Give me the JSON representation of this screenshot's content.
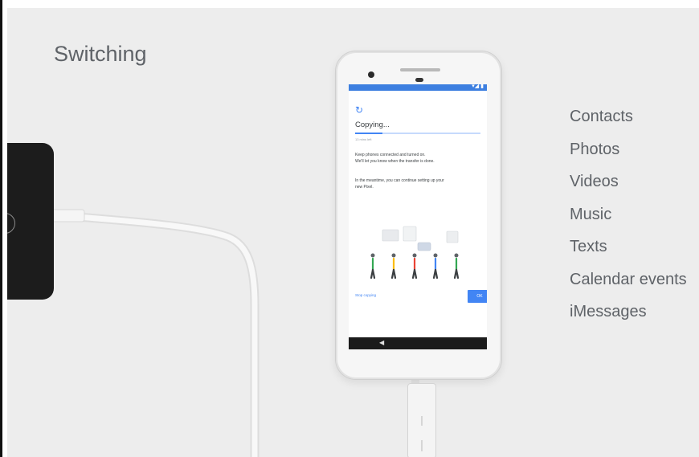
{
  "slide": {
    "title": "Switching",
    "items": [
      "Contacts",
      "Photos",
      "Videos",
      "Music",
      "Texts",
      "Calendar events",
      "iMessages"
    ]
  },
  "screen": {
    "status_icons": "▾◢ ▮",
    "title": "Copying...",
    "progress": 0.22,
    "time_left": "13 mins left",
    "paragraph1": [
      "Keep phones connected and turned on.",
      "We'll let you know when the transfer is done."
    ],
    "paragraph2": [
      "In the meantime, you can continue setting up your",
      "new Pixel."
    ],
    "stop_label": "Stop copying",
    "ok_label": "OK"
  },
  "colors": {
    "background": "#ededed",
    "text": "#5f6368",
    "accent": "#4285f4",
    "status_bar": "#3d7fe0"
  },
  "icons": {
    "copy": "history-icon",
    "back": "back-triangle-icon",
    "old_phone_home": "home-button-icon"
  }
}
